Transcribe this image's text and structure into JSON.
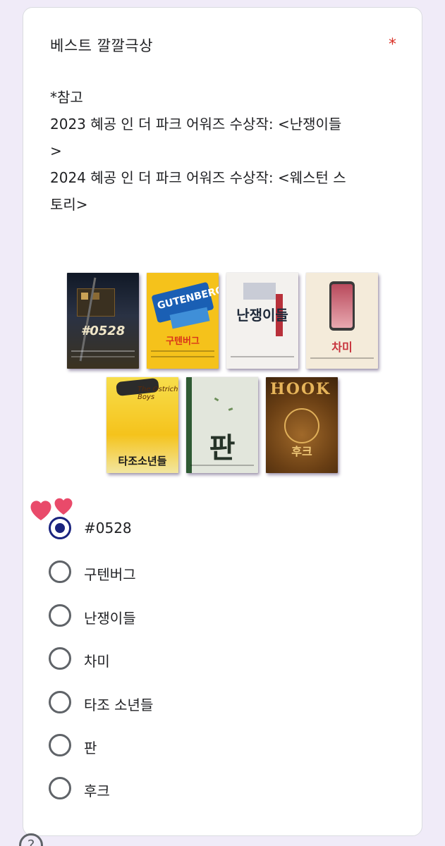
{
  "question": {
    "title": "베스트 깔깔극상",
    "required_mark": "*",
    "description": [
      "*참고",
      "2023 혜공 인 더 파크 어워즈 수상작: <난쟁이들",
      ">",
      "2024 혜공 인 더 파크 어워즈 수상작: <웨스턴 스",
      "토리>"
    ]
  },
  "posters": [
    {
      "name": "poster-0528",
      "text": "#0528",
      "bg": "#1c2433"
    },
    {
      "name": "poster-gutenberg",
      "text": "구텐버그",
      "bg": "#f5c21b"
    },
    {
      "name": "poster-nanjaengideul",
      "text": "난쟁이들",
      "bg": "#f2f0ec"
    },
    {
      "name": "poster-chami",
      "text": "차미",
      "bg": "#f3ead9"
    },
    {
      "name": "poster-tajo",
      "text": "타조소년들",
      "bg": "#f6d94a"
    },
    {
      "name": "poster-pan",
      "text": "판",
      "bg": "#dfe4d9"
    },
    {
      "name": "poster-hook",
      "text": "후크",
      "bg": "#6e4316"
    }
  ],
  "options": [
    {
      "label": "#0528",
      "checked": true
    },
    {
      "label": "구텐버그",
      "checked": false
    },
    {
      "label": "난쟁이들",
      "checked": false
    },
    {
      "label": "차미",
      "checked": false
    },
    {
      "label": "타조 소년들",
      "checked": false
    },
    {
      "label": "판",
      "checked": false
    },
    {
      "label": "후크",
      "checked": false
    }
  ],
  "colors": {
    "background": "#f0ebf8",
    "accent": "#1a237e",
    "required": "#d93025",
    "heart": "#e94a6a"
  },
  "icons": {
    "hearts": "hearts-sticker-icon",
    "help": "help-icon"
  }
}
